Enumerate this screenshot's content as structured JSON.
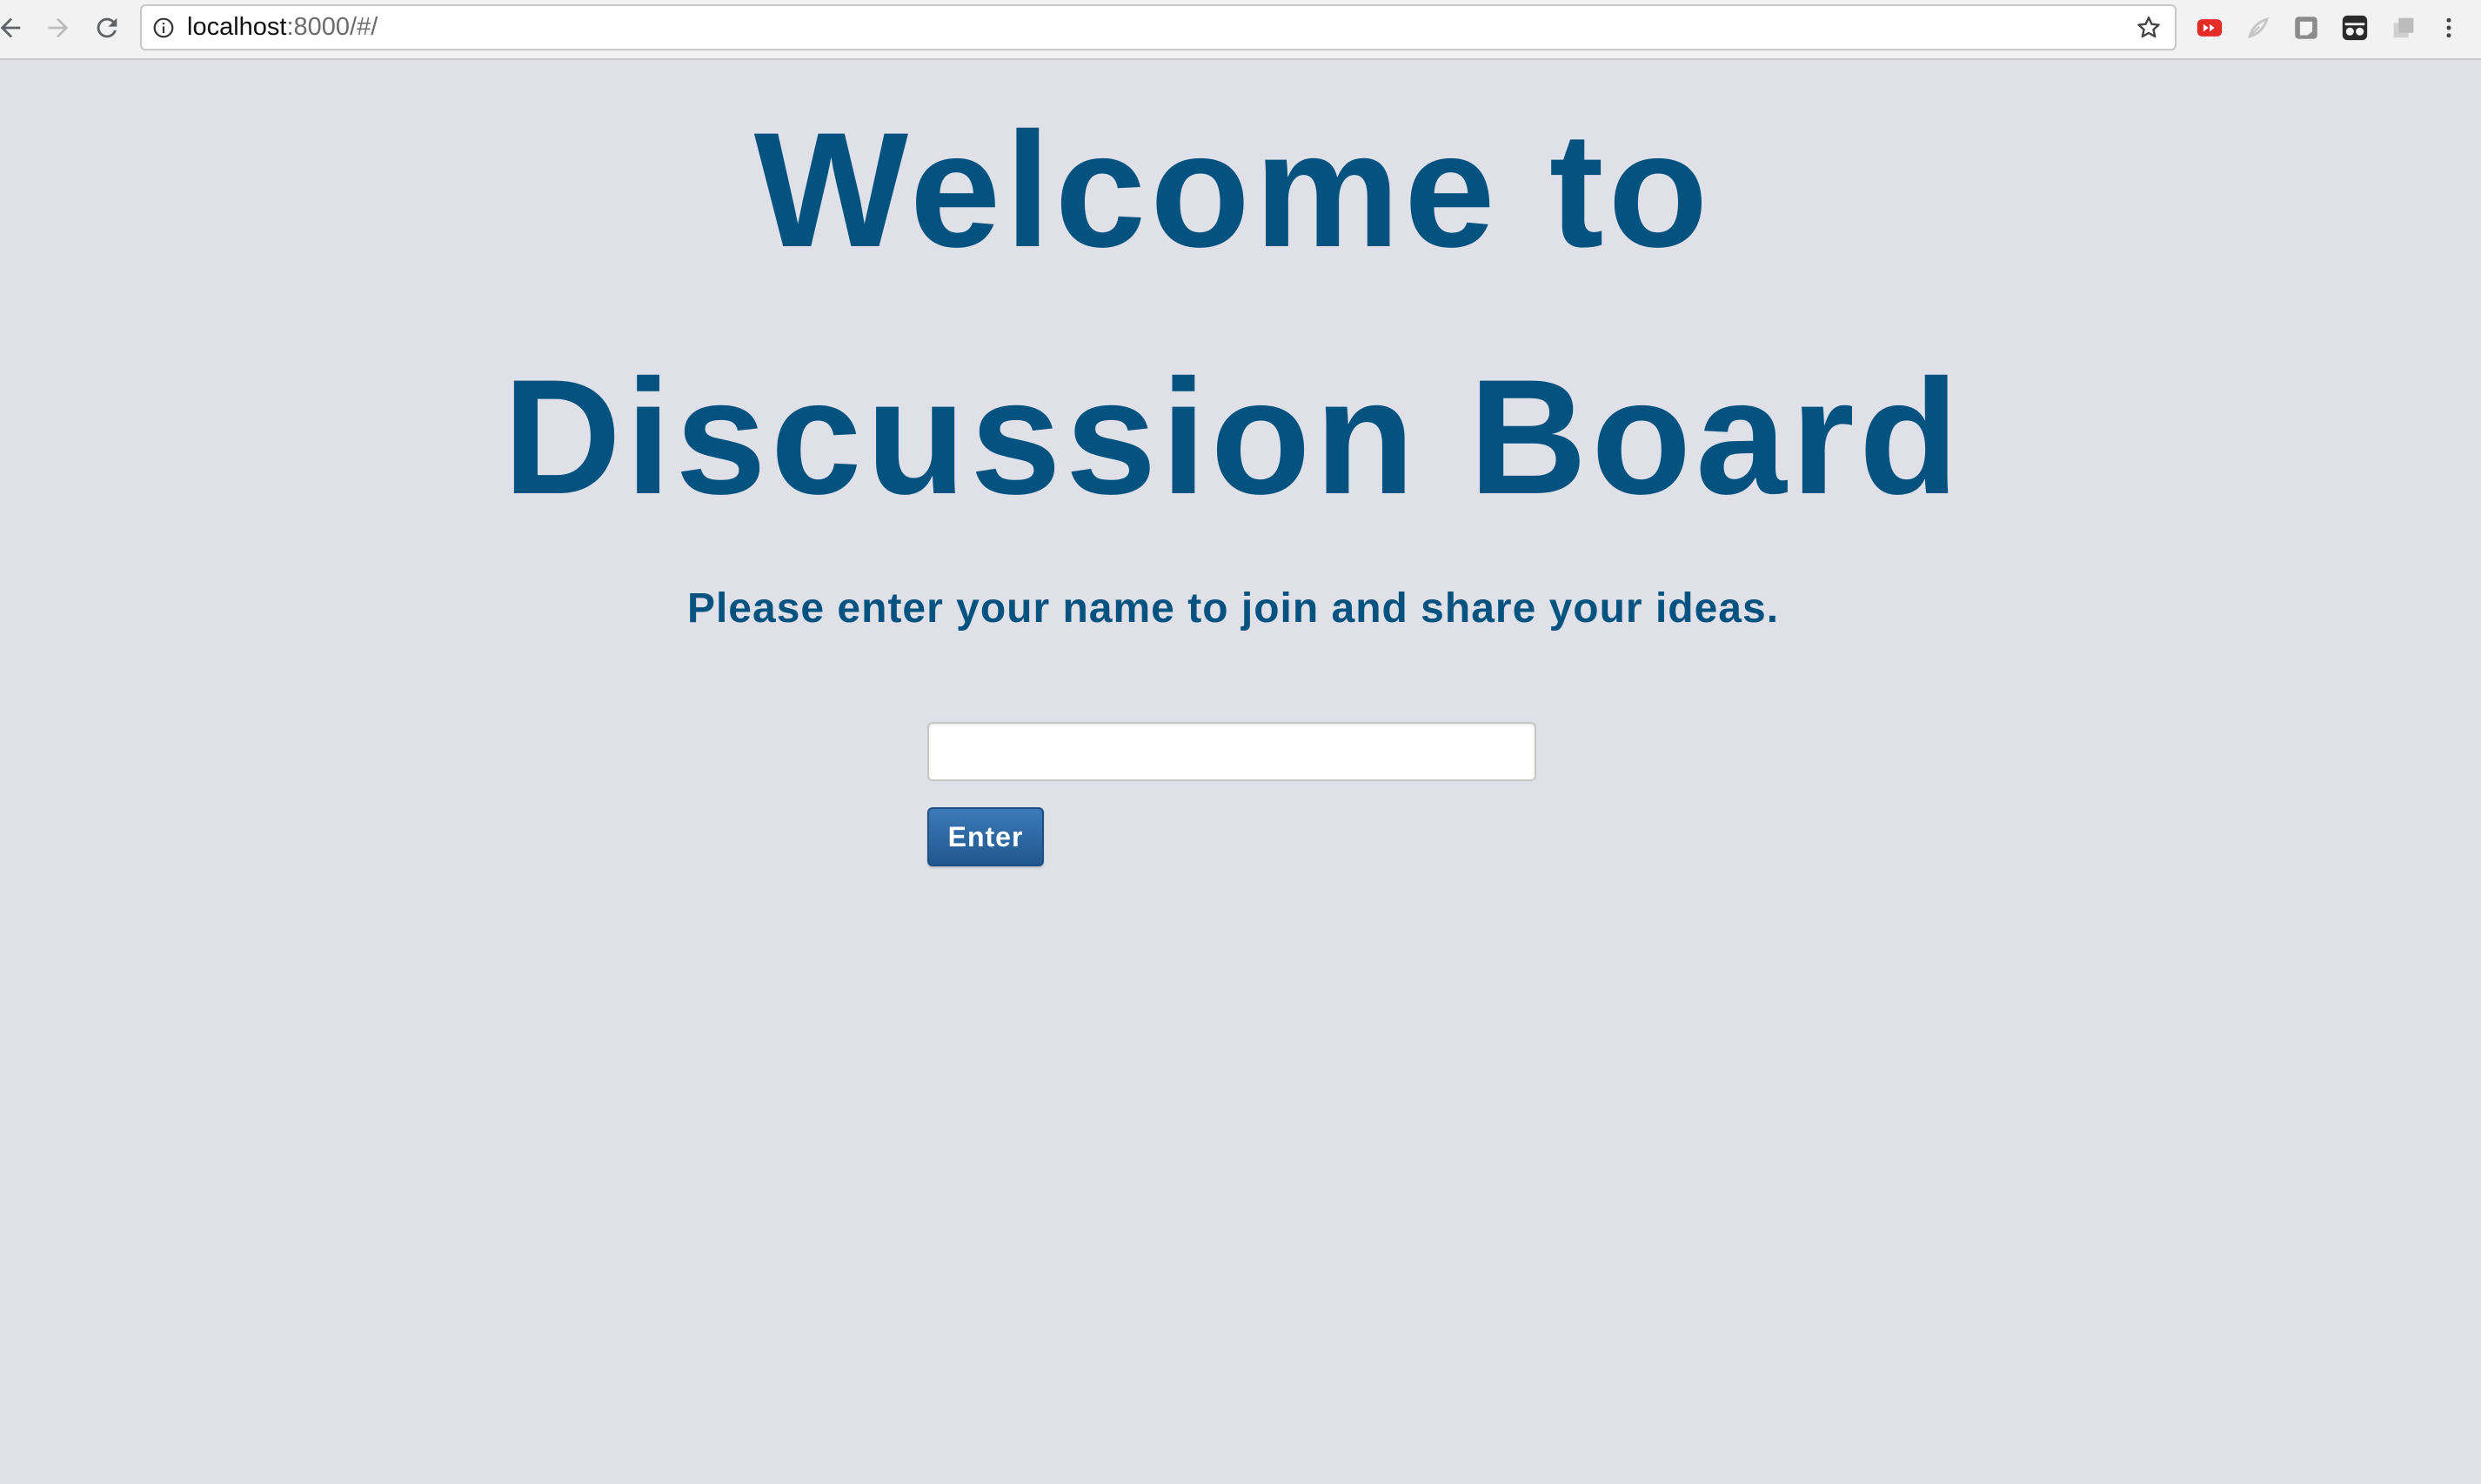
{
  "browser": {
    "url_host": "localhost",
    "url_rest": ":8000/#/"
  },
  "page": {
    "title_line1": "Welcome to",
    "title_line2": "Discussion Board",
    "subtitle": "Please enter your name to join and share your ideas.",
    "name_input_value": "",
    "enter_label": "Enter"
  },
  "colors": {
    "background": "#e0e0e8",
    "heading": "#03527f",
    "button": "#2a62a0"
  },
  "icons": {
    "back": "back-arrow-icon",
    "forward": "forward-arrow-icon",
    "reload": "reload-icon",
    "site_info": "info-icon",
    "bookmark": "star-icon",
    "extensions": [
      "youtube-extension-icon",
      "feather-extension-icon",
      "box-extension-icon",
      "incognito-extension-icon",
      "stack-extension-icon"
    ],
    "menu": "kebab-menu-icon"
  }
}
